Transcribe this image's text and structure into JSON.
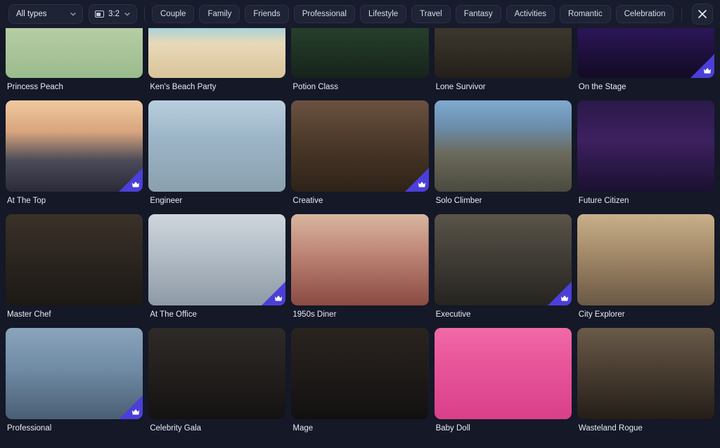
{
  "toolbar": {
    "type_filter": {
      "label": "All types",
      "icon": "chevron-down-icon"
    },
    "ratio_filter": {
      "label": "3:2",
      "icon": "frame-icon"
    },
    "chips": [
      {
        "label": "Couple"
      },
      {
        "label": "Family"
      },
      {
        "label": "Friends"
      },
      {
        "label": "Professional"
      },
      {
        "label": "Lifestyle"
      },
      {
        "label": "Travel"
      },
      {
        "label": "Fantasy"
      },
      {
        "label": "Activities"
      },
      {
        "label": "Romantic"
      },
      {
        "label": "Celebration"
      }
    ],
    "close": {
      "label": "×",
      "icon": "close-icon"
    }
  },
  "colors": {
    "background": "#141827",
    "toolbar": "#171B2B",
    "control": "#1E2335",
    "border": "#2B3148",
    "text": "#E8EAF2",
    "badge": "#4B3FD8"
  },
  "gallery": {
    "cards": [
      {
        "title": "Princess Peach",
        "premium": false,
        "art": "peach"
      },
      {
        "title": "Ken's Beach Party",
        "premium": false,
        "art": "beach"
      },
      {
        "title": "Potion Class",
        "premium": false,
        "art": "potion"
      },
      {
        "title": "Lone Survivor",
        "premium": false,
        "art": "survivor"
      },
      {
        "title": "On the Stage",
        "premium": true,
        "art": "stage"
      },
      {
        "title": "At The Top",
        "premium": true,
        "art": "attop"
      },
      {
        "title": "Engineer",
        "premium": false,
        "art": "engineer"
      },
      {
        "title": "Creative",
        "premium": true,
        "art": "creative"
      },
      {
        "title": "Solo Climber",
        "premium": false,
        "art": "climber"
      },
      {
        "title": "Future Citizen",
        "premium": false,
        "art": "future"
      },
      {
        "title": "Master Chef",
        "premium": false,
        "art": "chef"
      },
      {
        "title": "At The Office",
        "premium": true,
        "art": "office"
      },
      {
        "title": "1950s Diner",
        "premium": false,
        "art": "diner"
      },
      {
        "title": "Executive",
        "premium": true,
        "art": "executive"
      },
      {
        "title": "City Explorer",
        "premium": false,
        "art": "explorer"
      },
      {
        "title": "Professional",
        "premium": true,
        "art": "professional"
      },
      {
        "title": "Celebrity Gala",
        "premium": false,
        "art": "gala"
      },
      {
        "title": "Mage",
        "premium": false,
        "art": "mage"
      },
      {
        "title": "Baby Doll",
        "premium": false,
        "art": "babydoll"
      },
      {
        "title": "Wasteland Rogue",
        "premium": false,
        "art": "wasteland"
      }
    ]
  }
}
